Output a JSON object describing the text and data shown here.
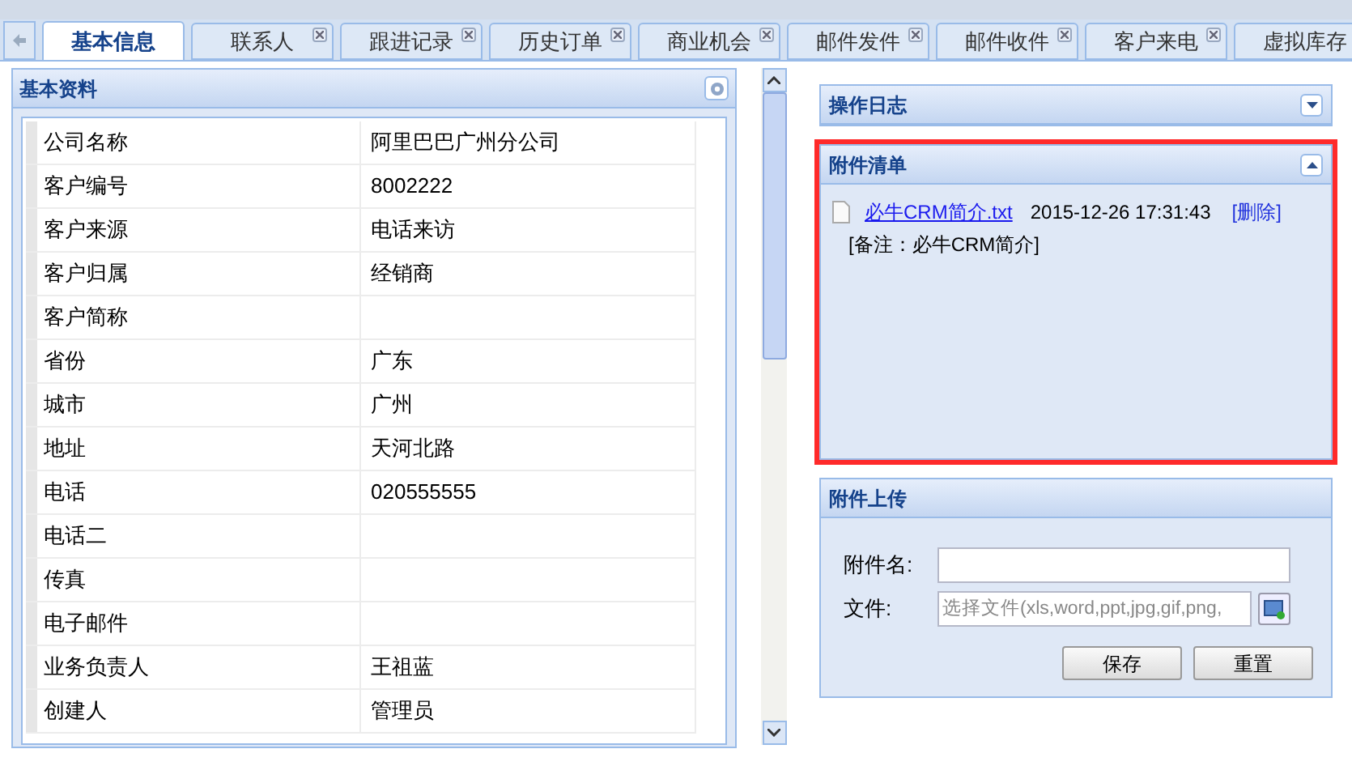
{
  "tabs": [
    {
      "label": "基本信息",
      "selected": true,
      "closable": false
    },
    {
      "label": "联系人",
      "selected": false,
      "closable": true
    },
    {
      "label": "跟进记录",
      "selected": false,
      "closable": true
    },
    {
      "label": "历史订单",
      "selected": false,
      "closable": true
    },
    {
      "label": "商业机会",
      "selected": false,
      "closable": true
    },
    {
      "label": "邮件发件",
      "selected": false,
      "closable": true
    },
    {
      "label": "邮件收件",
      "selected": false,
      "closable": true
    },
    {
      "label": "客户来电",
      "selected": false,
      "closable": true
    },
    {
      "label": "虚拟库存",
      "selected": false,
      "closable": false
    }
  ],
  "basic_info": {
    "title": "基本资料",
    "rows": [
      {
        "label": "公司名称",
        "value": "阿里巴巴广州分公司"
      },
      {
        "label": "客户编号",
        "value": "8002222"
      },
      {
        "label": "客户来源",
        "value": "电话来访"
      },
      {
        "label": "客户归属",
        "value": "经销商"
      },
      {
        "label": "客户简称",
        "value": ""
      },
      {
        "label": "省份",
        "value": "广东"
      },
      {
        "label": "城市",
        "value": "广州"
      },
      {
        "label": "地址",
        "value": "天河北路"
      },
      {
        "label": "电话",
        "value": "020555555"
      },
      {
        "label": "电话二",
        "value": ""
      },
      {
        "label": "传真",
        "value": ""
      },
      {
        "label": "电子邮件",
        "value": ""
      },
      {
        "label": "业务负责人",
        "value": "王祖蓝"
      },
      {
        "label": "创建人",
        "value": "管理员"
      }
    ]
  },
  "operation_log": {
    "title": "操作日志",
    "expanded": false
  },
  "attachments": {
    "title": "附件清单",
    "expanded": true,
    "highlighted": true,
    "items": [
      {
        "file": "必牛CRM简介.txt",
        "time": "2015-12-26 17:31:43",
        "delete": "[删除]",
        "note": "[备注：必牛CRM简介]"
      }
    ]
  },
  "upload": {
    "title": "附件上传",
    "name_label": "附件名:",
    "file_label": "文件:",
    "file_placeholder": "选择文件(xls,word,ppt,jpg,gif,png,",
    "buttons": [
      "保存",
      "重置"
    ]
  }
}
